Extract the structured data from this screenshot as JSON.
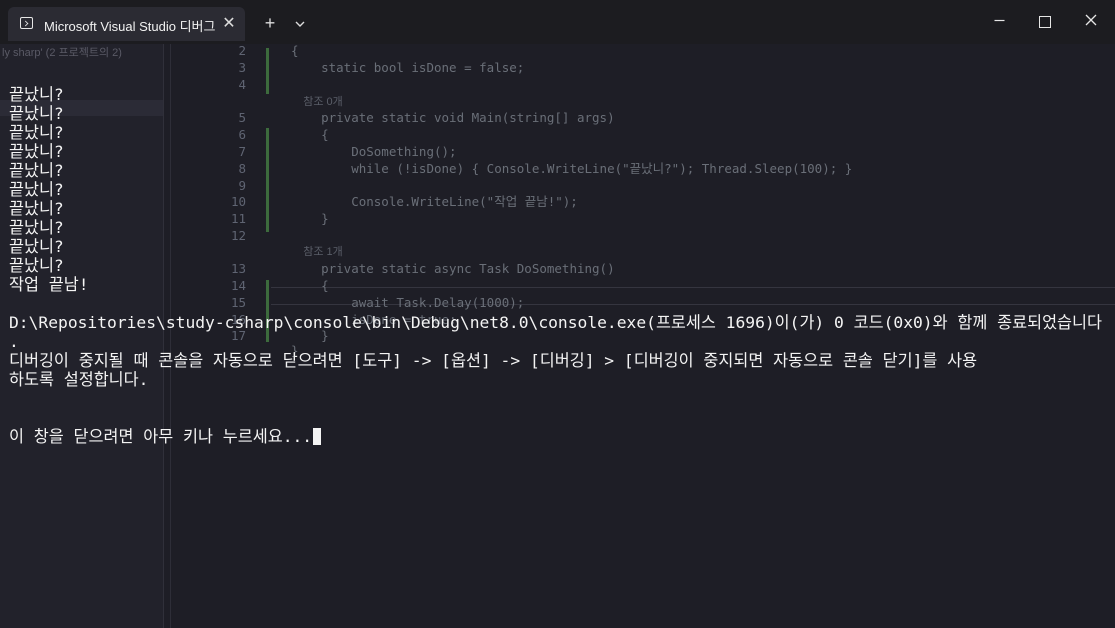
{
  "window": {
    "tab_title": "Microsoft Visual Studio 디버그",
    "tab_icon": "console-icon",
    "close_tab": "✕",
    "new_tab": "+",
    "dropdown": "⌄",
    "minimize": "—",
    "close": "✕"
  },
  "background": {
    "solution_hint": "ly sharp' (2 프로젝트의 2)",
    "code": [
      {
        "n": "2",
        "text": "{"
      },
      {
        "n": "3",
        "text": "    static bool isDone = false;"
      },
      {
        "n": "4",
        "text": ""
      },
      {
        "n": "",
        "text": "    참조 0개"
      },
      {
        "n": "5",
        "text": "    private static void Main(string[] args)"
      },
      {
        "n": "6",
        "text": "    {"
      },
      {
        "n": "7",
        "text": "        DoSomething();"
      },
      {
        "n": "8",
        "text": "        while (!isDone) { Console.WriteLine(\"끝났니?\"); Thread.Sleep(100); }"
      },
      {
        "n": "9",
        "text": ""
      },
      {
        "n": "10",
        "text": "        Console.WriteLine(\"작업 끝남!\");"
      },
      {
        "n": "11",
        "text": "    }"
      },
      {
        "n": "12",
        "text": ""
      },
      {
        "n": "",
        "text": "    참조 1개"
      },
      {
        "n": "13",
        "text": "    private static async Task DoSomething()"
      },
      {
        "n": "14",
        "text": "    {"
      },
      {
        "n": "15",
        "text": "        await Task.Delay(1000);"
      },
      {
        "n": "16",
        "text": "        isDone = true;"
      },
      {
        "n": "17",
        "text": "    }"
      },
      {
        "n": "",
        "text": "}"
      }
    ]
  },
  "console": {
    "lines": [
      "끝났니?",
      "끝났니?",
      "끝났니?",
      "끝났니?",
      "끝났니?",
      "끝났니?",
      "끝났니?",
      "끝났니?",
      "끝났니?",
      "끝났니?",
      "작업 끝남!",
      "",
      "D:\\Repositories\\study-csharp\\console\\bin\\Debug\\net8.0\\console.exe(프로세스 1696)이(가) 0 코드(0x0)와 함께 종료되었습니다",
      ".",
      "디버깅이 중지될 때 콘솔을 자동으로 닫으려면 [도구] -> [옵션] -> [디버깅] > [디버깅이 중지되면 자동으로 콘솔 닫기]를 사용",
      "하도록 설정합니다."
    ],
    "prompt": "이 창을 닫으려면 아무 키나 누르세요..."
  }
}
